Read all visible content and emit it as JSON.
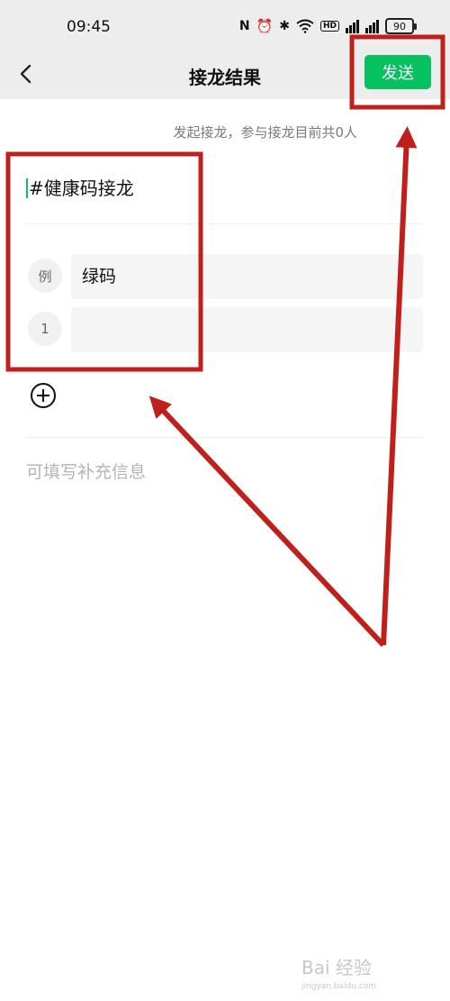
{
  "status_bar": {
    "time": "09:45",
    "battery": "90",
    "icons": [
      "nfc-icon",
      "alarm-icon",
      "bluetooth-icon",
      "wifi-icon",
      "hd-icon",
      "signal-5g-icon",
      "signal-4g-icon",
      "battery-icon"
    ]
  },
  "nav": {
    "title": "接龙结果",
    "send_label": "发送"
  },
  "subtitle": "发起接龙，参与接龙目前共0人",
  "topic": "#健康码接龙",
  "items": [
    {
      "index": "例",
      "value": "绿码"
    },
    {
      "index": "1",
      "value": ""
    }
  ],
  "supplement_placeholder": "可填写补充信息",
  "watermark": "Bai 经验",
  "watermark_sub": "jingyan.baidu.com",
  "colors": {
    "accent_green": "#07c160",
    "annotation_red": "#c0201c",
    "bar_bg": "#ededed"
  }
}
